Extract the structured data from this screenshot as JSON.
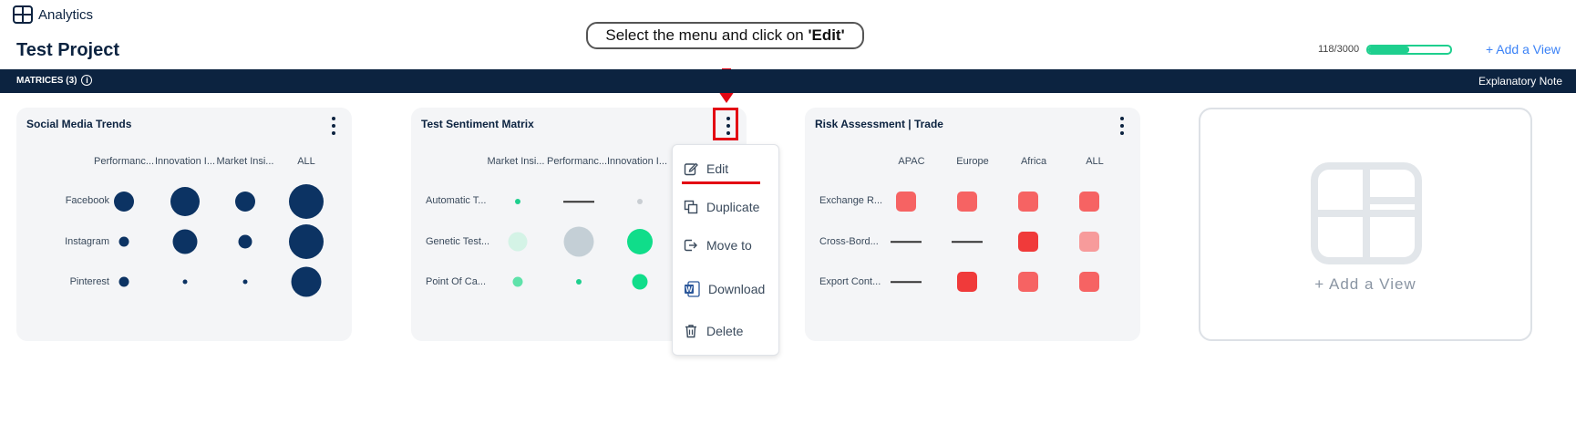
{
  "app": {
    "name": "Analytics"
  },
  "project": {
    "title": "Test Project"
  },
  "hint": {
    "prefix": "Select the menu and click on ",
    "emphasis": "'Edit'"
  },
  "usage": {
    "text": "118/3000",
    "fill_fraction": 0.5,
    "color": "#1ecf8e"
  },
  "header_actions": {
    "add_view": "+ Add a View"
  },
  "bar": {
    "matrices_label": "MATRICES (3)",
    "info": "i",
    "explanatory_note": "Explanatory Note"
  },
  "cards": [
    {
      "title": "Social Media Trends",
      "columns": [
        "Performanc...",
        "Innovation I...",
        "Market Insi...",
        "ALL"
      ],
      "rows": [
        "Facebook",
        "Instagram",
        "Pinterest"
      ]
    },
    {
      "title": "Test Sentiment Matrix",
      "columns": [
        "Market Insi...",
        "Performanc...",
        "Innovation I..."
      ],
      "rows": [
        "Automatic T...",
        "Genetic Test...",
        "Point Of Ca..."
      ]
    },
    {
      "title": "Risk Assessment | Trade",
      "columns": [
        "APAC",
        "Europe",
        "Africa",
        "ALL"
      ],
      "rows": [
        "Exchange R...",
        "Cross-Bord...",
        "Export Cont..."
      ]
    }
  ],
  "empty_card": {
    "label": "+ Add a View"
  },
  "menu": {
    "items": [
      {
        "label": "Edit",
        "icon": "edit-icon"
      },
      {
        "label": "Duplicate",
        "icon": "duplicate-icon"
      },
      {
        "label": "Move to",
        "icon": "move-icon"
      },
      {
        "label": "Download",
        "icon": "word-document-icon"
      },
      {
        "label": "Delete",
        "icon": "trash-icon"
      }
    ]
  },
  "colors": {
    "navy": "#0c2340",
    "green": "#1ecf8e",
    "red": "#e30613",
    "link": "#3b82f6"
  }
}
